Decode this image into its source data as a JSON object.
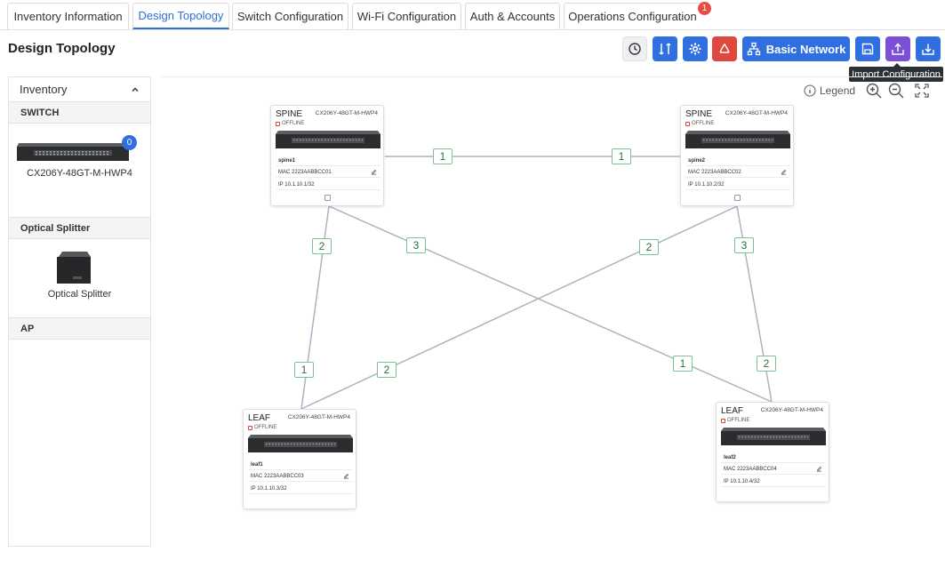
{
  "tabs": [
    {
      "label": "Inventory Information"
    },
    {
      "label": "Design Topology"
    },
    {
      "label": "Switch Configuration"
    },
    {
      "label": "Wi-Fi Configuration"
    },
    {
      "label": "Auth & Accounts"
    },
    {
      "label": "Operations Configuration",
      "badge": "1"
    }
  ],
  "page": {
    "title": "Design Topology"
  },
  "toolbar": {
    "basic_network_label": "Basic Network",
    "tooltip": "Import Configuration",
    "icons": [
      "history-icon",
      "swap-icon",
      "gear-icon",
      "recycle-icon",
      "network-icon",
      "save-icon",
      "upload-icon",
      "download-icon"
    ]
  },
  "inventory": {
    "title": "Inventory",
    "sections": [
      {
        "name": "SWITCH",
        "items": [
          {
            "label": "CX206Y-48GT-M-HWP4",
            "count": "0"
          }
        ]
      },
      {
        "name": "Optical Splitter",
        "items": [
          {
            "label": "Optical Splitter"
          }
        ]
      },
      {
        "name": "AP",
        "items": []
      }
    ]
  },
  "canvas": {
    "legend_label": "Legend"
  },
  "devices": [
    {
      "role": "SPINE",
      "model": "CX206Y-48GT-M-HWP4",
      "status": "OFFLINE",
      "name": "spine1",
      "mac": "MAC 2223AABBCC01",
      "ip": "IP 10.1.10.1/32"
    },
    {
      "role": "SPINE",
      "model": "CX206Y-48GT-M-HWP4",
      "status": "OFFLINE",
      "name": "spine2",
      "mac": "MAC 2223AABBCC02",
      "ip": "IP 10.1.10.2/32"
    },
    {
      "role": "LEAF",
      "model": "CX206Y-48GT-M-HWP4",
      "status": "OFFLINE",
      "name": "leaf1",
      "mac": "MAC 2223AABBCC03",
      "ip": "IP 10.1.10.3/32"
    },
    {
      "role": "LEAF",
      "model": "CX206Y-48GT-M-HWP4",
      "status": "OFFLINE",
      "name": "leaf2",
      "mac": "MAC 2223AABBCC04",
      "ip": "IP 10.1.10.4/32"
    }
  ],
  "port_labels": [
    "1",
    "1",
    "2",
    "3",
    "2",
    "3",
    "1",
    "2",
    "1",
    "2"
  ],
  "colors": {
    "accent": "#2f6fe0",
    "danger": "#e0473f",
    "purple": "#7b4fd6",
    "port_border": "#7bc292",
    "link": "#a9b4c2"
  }
}
